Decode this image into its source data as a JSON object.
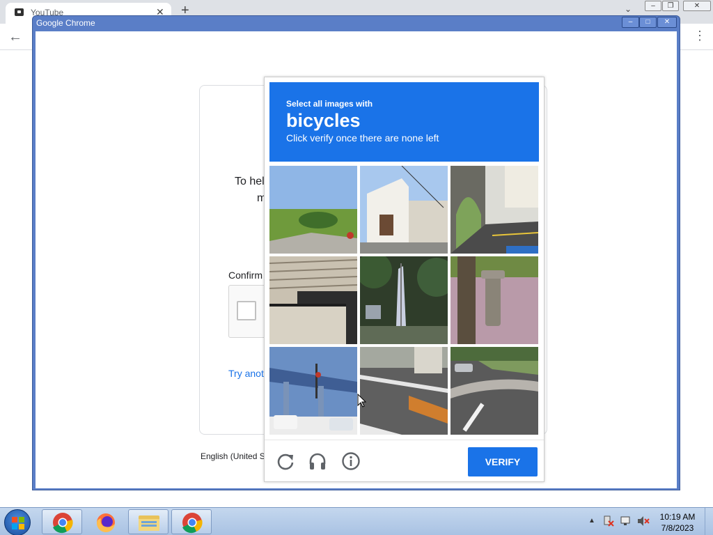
{
  "background_browser": {
    "tab_title": "YouTube",
    "tab_close": "✕",
    "new_tab": "+",
    "tab_search": "⌄",
    "win_minimize": "–",
    "win_restore": "❐",
    "win_close": "✕",
    "back": "←",
    "menu": "⋮"
  },
  "window": {
    "title": "Google Chrome",
    "minimize": "–",
    "maximize": "□",
    "close": "✕"
  },
  "page": {
    "help_line1": "To hel",
    "help_line2": "m",
    "confirm_label": "Confirm",
    "try_another": "Try anot",
    "language": "English (United S"
  },
  "captcha": {
    "instruction_small": "Select all images with",
    "target": "bicycles",
    "instruction_sub": "Click verify once there are none left",
    "verify_label": "VERIFY",
    "tiles": [
      {
        "name": "tile-road-field"
      },
      {
        "name": "tile-houses"
      },
      {
        "name": "tile-archway-street"
      },
      {
        "name": "tile-balcony"
      },
      {
        "name": "tile-flag-trees"
      },
      {
        "name": "tile-tree-bollard"
      },
      {
        "name": "tile-overpass-cars"
      },
      {
        "name": "tile-street-crosswalk"
      },
      {
        "name": "tile-curved-road"
      }
    ],
    "footer_icons": [
      "reload-icon",
      "audio-icon",
      "info-icon"
    ]
  },
  "taskbar": {
    "apps": [
      "chrome-icon",
      "firefox-icon",
      "file-explorer-icon",
      "chrome-icon"
    ],
    "tray_arrow": "▲",
    "time": "10:19 AM",
    "date": "7/8/2023"
  },
  "colors": {
    "accent": "#1a73e8",
    "window_frame": "#5a7ec7"
  }
}
